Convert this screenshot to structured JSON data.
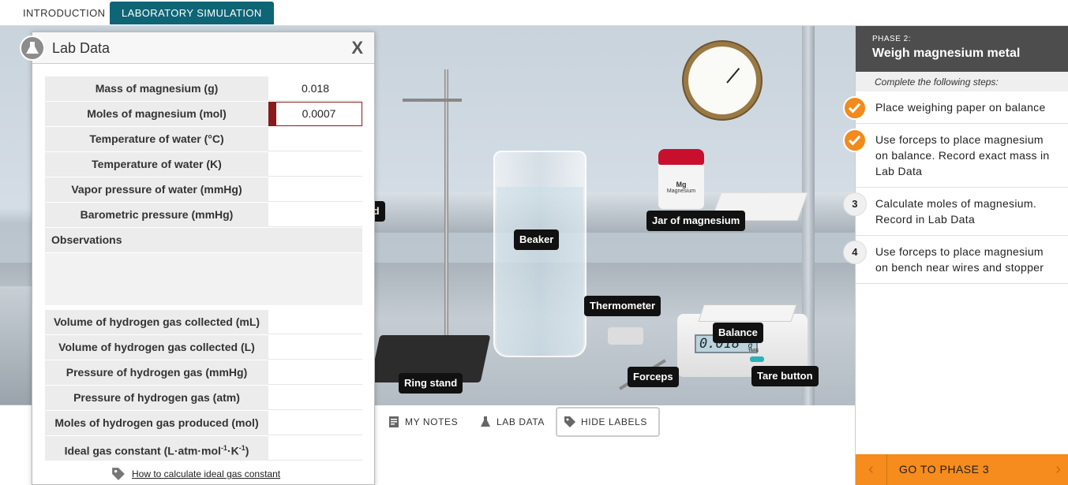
{
  "tabs": {
    "introduction": "INTRODUCTION",
    "simulation": "LABORATORY SIMULATION"
  },
  "scene": {
    "labels": {
      "acid_partial": "id",
      "beaker": "Beaker",
      "jar": "Jar of magnesium",
      "thermometer": "Thermometer",
      "balance": "Balance",
      "ring_stand": "Ring stand",
      "forceps": "Forceps",
      "tare": "Tare button"
    },
    "jar_text": "Mg",
    "jar_sub": "Magnesium",
    "balance_reading": "0.018",
    "balance_unit": "g",
    "tare_text": "TARE"
  },
  "toolbar": {
    "notes": "MY NOTES",
    "lab_data": "LAB DATA",
    "hide_labels": "HIDE LABELS"
  },
  "lab_data": {
    "title": "Lab Data",
    "close": "X",
    "rows_top": [
      {
        "label": "Mass of magnesium (g)",
        "value": "0.018"
      },
      {
        "label": "Moles of magnesium (mol)",
        "value": "0.0007"
      },
      {
        "label": "Temperature of water (°C)",
        "value": ""
      },
      {
        "label": "Temperature of water (K)",
        "value": ""
      },
      {
        "label": "Vapor pressure of water (mmHg)",
        "value": ""
      },
      {
        "label": "Barometric pressure (mmHg)",
        "value": ""
      }
    ],
    "observations_label": "Observations",
    "rows_bottom": [
      {
        "label": "Volume of hydrogen gas collected (mL)",
        "value": ""
      },
      {
        "label": "Volume of hydrogen gas collected (L)",
        "value": ""
      },
      {
        "label": "Pressure of hydrogen gas (mmHg)",
        "value": ""
      },
      {
        "label": "Pressure of hydrogen gas (atm)",
        "value": ""
      },
      {
        "label": "Moles of hydrogen gas produced (mol)",
        "value": ""
      }
    ],
    "gas_constant_label_parts": [
      "Ideal gas constant (L·atm·mol",
      "-1",
      "·K",
      "-1",
      ")"
    ],
    "gas_constant_value": "",
    "help_link": "How to calculate ideal gas constant"
  },
  "phase": {
    "number_label": "PHASE 2:",
    "title": "Weigh magnesium metal",
    "instruction": "Complete the following steps:",
    "steps": [
      {
        "status": "done",
        "marker": "",
        "text": "Place weighing paper on balance"
      },
      {
        "status": "done",
        "marker": "",
        "text": "Use forceps to place magnesium on balance. Record exact mass in Lab Data"
      },
      {
        "status": "todo",
        "marker": "3",
        "text": "Calculate moles of magnesium. Record in Lab Data"
      },
      {
        "status": "todo",
        "marker": "4",
        "text": "Use forceps to place magnesium on bench near wires and stopper"
      }
    ],
    "next_button": "GO TO PHASE 3"
  },
  "colors": {
    "accent_teal": "#0e6575",
    "accent_orange": "#f68b1e",
    "focus_red": "#8b1a1a"
  }
}
